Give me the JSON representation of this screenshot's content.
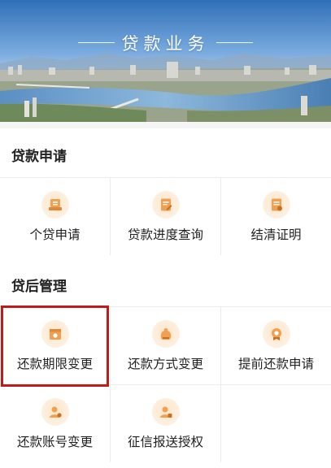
{
  "banner": {
    "title": "贷款业务"
  },
  "sections": [
    {
      "title": "贷款申请",
      "items": [
        {
          "label": "个贷申请",
          "icon": "loan-apply-icon"
        },
        {
          "label": "贷款进度查询",
          "icon": "progress-query-icon"
        },
        {
          "label": "结清证明",
          "icon": "settlement-certificate-icon"
        }
      ]
    },
    {
      "title": "贷后管理",
      "items": [
        {
          "label": "还款期限变更",
          "icon": "repayment-term-icon"
        },
        {
          "label": "还款方式变更",
          "icon": "repayment-method-icon"
        },
        {
          "label": "提前还款申请",
          "icon": "prepayment-icon"
        },
        {
          "label": "还款账号变更",
          "icon": "account-change-icon"
        },
        {
          "label": "征信报送授权",
          "icon": "credit-report-icon"
        }
      ]
    }
  ],
  "colors": {
    "accent": "#f0a050",
    "icon_bg": "#fde9d0",
    "highlight": "#c01a1a"
  }
}
